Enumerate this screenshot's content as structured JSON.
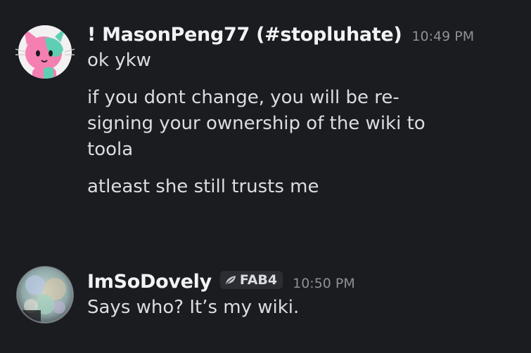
{
  "messages": [
    {
      "username": "! MasonPeng77 (#stopluhate)",
      "timestamp": "10:49 PM",
      "avatar_icon": "pink-cat-avatar",
      "lines": [
        "ok ykw",
        "if you dont change, you will be re-\nsigning your ownership of the wiki to\ntoola",
        "atleast she still trusts me"
      ]
    },
    {
      "username": "ImSoDovely",
      "tag": "FAB4",
      "tag_icon": "leaf-icon",
      "timestamp": "10:50 PM",
      "avatar_icon": "bubble-collage-avatar",
      "lines": [
        "Says who? It’s my wiki."
      ]
    }
  ],
  "colors": {
    "background": "#1b1c20",
    "username": "#f2f3f5",
    "text": "#dcdde1",
    "timestamp": "#8e9097",
    "tag_bg": "#2c2d33"
  }
}
